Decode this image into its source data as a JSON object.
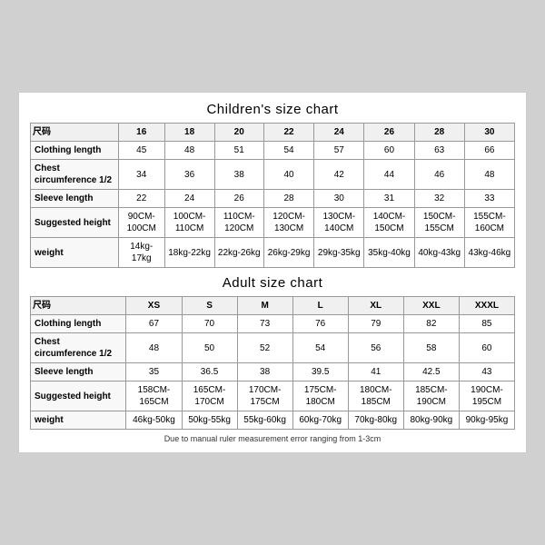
{
  "children_chart": {
    "title": "Children's size chart",
    "columns": [
      "尺码",
      "16",
      "18",
      "20",
      "22",
      "24",
      "26",
      "28",
      "30"
    ],
    "rows": [
      {
        "label": "Clothing length",
        "values": [
          "45",
          "48",
          "51",
          "54",
          "57",
          "60",
          "63",
          "66"
        ]
      },
      {
        "label": "Chest circumference 1/2",
        "values": [
          "34",
          "36",
          "38",
          "40",
          "42",
          "44",
          "46",
          "48"
        ]
      },
      {
        "label": "Sleeve length",
        "values": [
          "22",
          "24",
          "26",
          "28",
          "30",
          "31",
          "32",
          "33"
        ]
      },
      {
        "label": "Suggested height",
        "values": [
          "90CM-100CM",
          "100CM-110CM",
          "110CM-120CM",
          "120CM-130CM",
          "130CM-140CM",
          "140CM-150CM",
          "150CM-155CM",
          "155CM-160CM"
        ]
      },
      {
        "label": "weight",
        "values": [
          "14kg-17kg",
          "18kg-22kg",
          "22kg-26kg",
          "26kg-29kg",
          "29kg-35kg",
          "35kg-40kg",
          "40kg-43kg",
          "43kg-46kg"
        ]
      }
    ]
  },
  "adult_chart": {
    "title": "Adult size chart",
    "columns": [
      "尺码",
      "XS",
      "S",
      "M",
      "L",
      "XL",
      "XXL",
      "XXXL"
    ],
    "rows": [
      {
        "label": "Clothing length",
        "values": [
          "67",
          "70",
          "73",
          "76",
          "79",
          "82",
          "85"
        ]
      },
      {
        "label": "Chest circumference 1/2",
        "values": [
          "48",
          "50",
          "52",
          "54",
          "56",
          "58",
          "60"
        ]
      },
      {
        "label": "Sleeve length",
        "values": [
          "35",
          "36.5",
          "38",
          "39.5",
          "41",
          "42.5",
          "43"
        ]
      },
      {
        "label": "Suggested height",
        "values": [
          "158CM-165CM",
          "165CM-170CM",
          "170CM-175CM",
          "175CM-180CM",
          "180CM-185CM",
          "185CM-190CM",
          "190CM-195CM"
        ]
      },
      {
        "label": "weight",
        "values": [
          "46kg-50kg",
          "50kg-55kg",
          "55kg-60kg",
          "60kg-70kg",
          "70kg-80kg",
          "80kg-90kg",
          "90kg-95kg"
        ]
      }
    ]
  },
  "footer": {
    "note": "Due to manual ruler measurement error ranging from 1-3cm"
  }
}
